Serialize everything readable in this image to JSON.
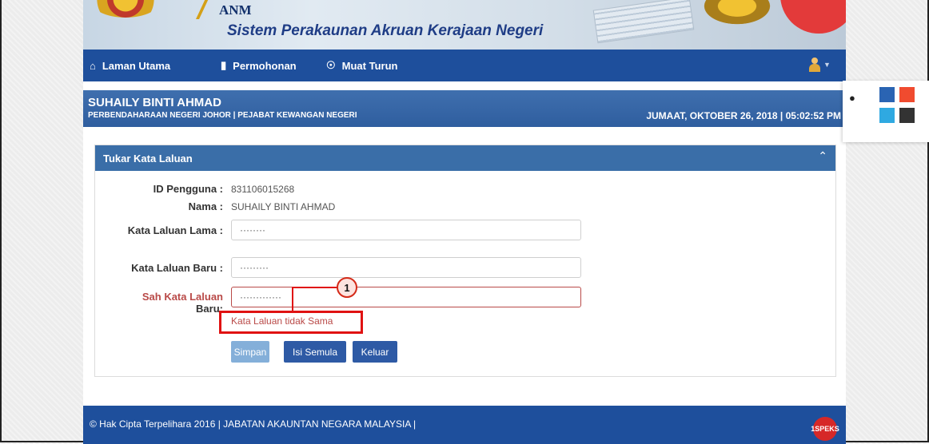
{
  "banner": {
    "agency": "ANM",
    "system_title": "Sistem Perakaunan Akruan Kerajaan Negeri"
  },
  "navbar": {
    "items": [
      {
        "label": "Laman Utama",
        "icon": "home-icon"
      },
      {
        "label": "Permohonan",
        "icon": "book-icon"
      },
      {
        "label": "Muat Turun",
        "icon": "download-icon"
      }
    ]
  },
  "info": {
    "user_name": "SUHAILY BINTI AHMAD",
    "organization": "PERBENDAHARAAN NEGERI JOHOR | PEJABAT KEWANGAN NEGERI",
    "datetime": "JUMAAT, OKTOBER 26, 2018 | 05:02:52 PM"
  },
  "panel": {
    "title": "Tukar Kata Laluan",
    "collapse_icon": "chevron-up-icon",
    "fields": {
      "user_id_label": "ID Pengguna :",
      "user_id_value": "831106015268",
      "name_label": "Nama :",
      "name_value": "SUHAILY BINTI AHMAD",
      "old_password_label": "Kata Laluan Lama :",
      "old_password_value": "········",
      "new_password_label": "Kata Laluan Baru :",
      "new_password_value": "·········",
      "confirm_password_label_line1": "Sah Kata Laluan",
      "confirm_password_label_line2": "Baru:",
      "confirm_password_value": "·············",
      "error_message": "Kata Laluan tidak Sama"
    },
    "buttons": {
      "save": "Simpan",
      "reset": "Isi Semula",
      "exit": "Keluar"
    }
  },
  "annotation": {
    "badge": "1"
  },
  "footer": {
    "text": "© Hak Cipta Terpelihara 2016 | JABATAN AKAUNTAN NEGARA MALAYSIA |",
    "logo_text": "1SPEKS"
  },
  "theme_picker": {
    "icon": "drop-icon",
    "swatches": [
      "#2a64b3",
      "#f04b2f",
      "#2fa9e1",
      "#333333"
    ]
  },
  "colors": {
    "nav": "#1e4f9c",
    "accent": "#3a6ea8",
    "error": "#b94a48",
    "callout": "#e01212"
  }
}
